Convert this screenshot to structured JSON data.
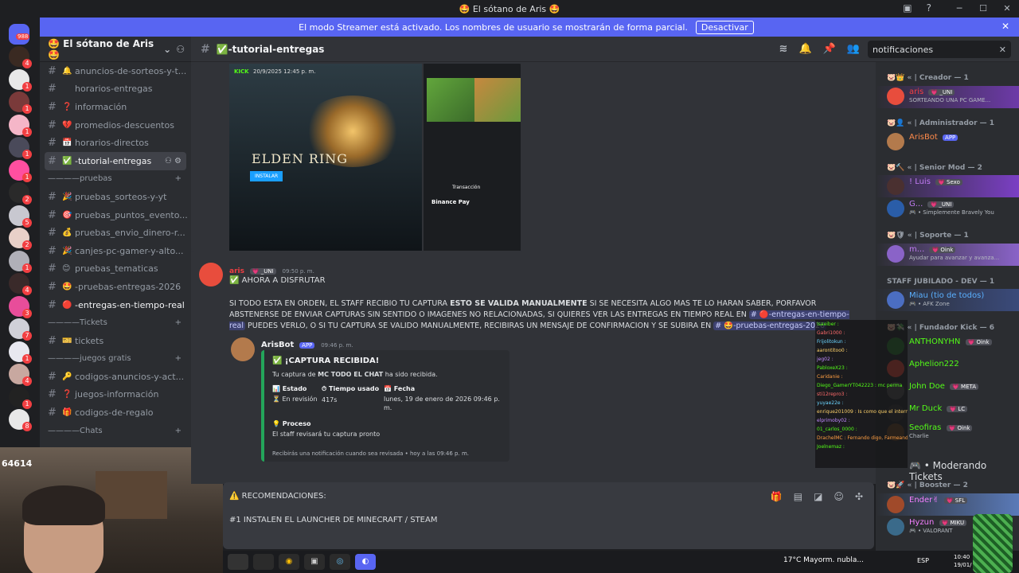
{
  "window": {
    "title": "🤩 El sótano de Aris 🤩"
  },
  "banner": {
    "text": "El modo Streamer está activado. Los nombres de usuario se mostrarán de forma parcial.",
    "button": "Desactivar"
  },
  "rail": {
    "dm_badge": "988",
    "badges": [
      "4",
      "1",
      "1",
      "1",
      "1",
      "1",
      "2",
      "5",
      "2",
      "1",
      "4",
      "3",
      "7",
      "1",
      "4",
      "1",
      "8"
    ]
  },
  "server": {
    "name": "🤩 El sótano de Aris 🤩"
  },
  "channels": [
    {
      "emoji": "🔔",
      "label": "anuncios-de-sorteos-y-t..."
    },
    {
      "emoji": "",
      "label": "horarios-entregas"
    },
    {
      "emoji": "❓",
      "label": "información"
    },
    {
      "emoji": "💔",
      "label": "promedios-descuentos"
    },
    {
      "emoji": "📅",
      "label": "horarios-directos"
    },
    {
      "emoji": "✅",
      "label": "-tutorial-entregas",
      "active": true
    }
  ],
  "cat_pruebas": "pruebas",
  "pruebas_channels": [
    {
      "emoji": "🎉",
      "label": "pruebas_sorteos-y-yt"
    },
    {
      "emoji": "🎯",
      "label": "pruebas_puntos_evento..."
    },
    {
      "emoji": "💰",
      "label": "pruebas_envio_dinero-r..."
    },
    {
      "emoji": "🎉",
      "label": "canjes-pc-gamer-y-alto..."
    },
    {
      "emoji": "😊",
      "label": "pruebas_tematicas"
    },
    {
      "emoji": "🤩",
      "label": "-pruebas-entregas-2026"
    },
    {
      "emoji": "🔴",
      "label": "-entregas-en-tiempo-real",
      "bold": true
    }
  ],
  "cat_tickets": "Tickets",
  "tickets_channels": [
    {
      "emoji": "🎫",
      "label": "tickets"
    }
  ],
  "cat_juegos": "juegos gratis",
  "juegos_channels": [
    {
      "emoji": "🔑",
      "label": "codigos-anuncios-y-act..."
    },
    {
      "emoji": "❓",
      "label": "juegos-información"
    },
    {
      "emoji": "🎁",
      "label": "codigos-de-regalo"
    }
  ],
  "cat_chats": "Chats",
  "webcam": {
    "overlay_num": "64614"
  },
  "header": {
    "channel": "✅-tutorial-entregas",
    "search_value": "notificaciones"
  },
  "screenshots": {
    "kick_date": "20/9/2025 12:45 p. m.",
    "elden": "ELDEN RING",
    "install": "INSTALAR",
    "tx": "Transacción",
    "bp": "Binance Pay",
    "kick": "KICK"
  },
  "message1": {
    "author": "aris",
    "author_tag": "💗 _UNI",
    "time": "09:50 p. m.",
    "line1": "✅ AHORA A DISFRUTAR",
    "p1a": "SI TODO ESTA EN ORDEN, EL STAFF RECIBIO TU CAPTURA ",
    "p1b": "ESTO SE VALIDA MANUALMENTE",
    "p1c": " SI SE NECESITA ALGO MAS TE LO HARAN SABER, PORFAVOR ABSTENERSE DE ENVIAR CAPTURAS SIN SENTIDO O IMAGENES NO RELACIONADAS, SI QUIERES VER LAS ENTREGAS EN TIEMPO REAL EN ",
    "mention1": "# 🔴-entregas-en-tiempo-real",
    "p1d": " PUEDES VERLO, O SI TU CAPTURA SE VALIDO MANUALMENTE, RECIBIRAS UN MENSAJE DE CONFIRMACION Y SE SUBIRA EN ",
    "mention2": "# 🤩-pruebas-entregas-2026"
  },
  "message2": {
    "author": "ArisBot",
    "app": "APP",
    "time": "09:46 p. m.",
    "embed": {
      "title": "✅ ¡CAPTURA RECIBIDA!",
      "desc_a": "Tu captura de ",
      "desc_b": "MC TODO EL CHAT",
      "desc_c": " ha sido recibida.",
      "f1_name": "📊 Estado",
      "f1_val": "⏳ En revisión",
      "f2_name": "⏱ Tiempo usado",
      "f2_val": "417s",
      "f3_name": "📅 Fecha",
      "f3_val": "lunes, 19 de enero de 2026 09:46 p. m.",
      "f4_name": "💡 Proceso",
      "f4_val": "El staff revisará tu captura pronto",
      "footer": "Recibirás una notificación cuando sea revisada • hoy a las 09:46 p. m."
    }
  },
  "composer": {
    "line1": "⚠️ RECOMENDACIONES:",
    "line2": "#1 INSTALEN EL LAUNCHER DE MINECRAFT / STEAM"
  },
  "members": {
    "cat_creador": "🐷👑 « | Creador — 1",
    "m_aris": "aris",
    "m_aris_tag": "💗 _UNI",
    "m_aris_status": "SORTEANDO UNA PC GAME...",
    "cat_admin": "🐷👤 « | Administrador — 1",
    "m_bot": "ArisBot",
    "m_bot_app": "APP",
    "cat_senior": "🐷🔨 « | Senior Mod — 2",
    "m_luis": "! Luis",
    "m_luis_tag": "💗 Sexo",
    "m_g": "G...",
    "m_g_tag": "💗 _UNI",
    "m_g_status": "🎮 • Simplemente Bravely You",
    "cat_soporte": "🐷🛡 « | Soporte — 1",
    "m_m": "m...",
    "m_m_tag": "💗 Oink",
    "m_m_status": "Ayudar para avanzar y avanza...",
    "cat_staff": "STAFF JUBILADO - DEV — 1",
    "m_miau": "Miau (tio de todos)",
    "m_miau_status": "🎮 • AFK Zone",
    "cat_fundador": "🐷💸 « | Fundador Kick — 6",
    "m_anth": "ANTHONYHN",
    "m_anth_tag": "💗 Oink",
    "m_aph": "Aphelion222",
    "m_john": "John Doe",
    "m_john_tag": "💗 META",
    "m_mr": "Mr Duck",
    "m_mr_tag": "💗 LC",
    "m_seo": "Seofiras",
    "m_seo_tag": "💗 Oink",
    "m_seo_status": "Charlie",
    "m_mod_status": "🎮 • Moderando Tickets",
    "cat_booster": "🐷🚀 « | Booster — 2",
    "m_ender": "Ender✌",
    "m_ender_tag": "💗 SFL",
    "m_hyzun": "Hyzun",
    "m_hyzun_tag": "💗 MIKU",
    "m_hyzun_status": "🎮 • VALORANT"
  },
  "kickchat": [
    "Isaeiber :",
    "Gabri1000 :",
    "Frijolitokun :",
    "aarontitoo0 :",
    "jeg02 :",
    "PabloxeX23 :",
    "Caridanie :",
    "Diego_GamerYT042223 : mc perma",
    "sti12repro3 :",
    "yuyae22e :",
    "enrique201009 : Is como que el internet lento, xdd",
    "elprimoby02 :",
    "01_carlos_0000 :",
    "DrachelMC : Fernando digo, Farmeando",
    "Joelnemaz :"
  ],
  "taskbar": {
    "weather": "17°C  Mayorm. nubla...",
    "lang": "ESP",
    "time": "10:40",
    "date": "19/01/"
  }
}
